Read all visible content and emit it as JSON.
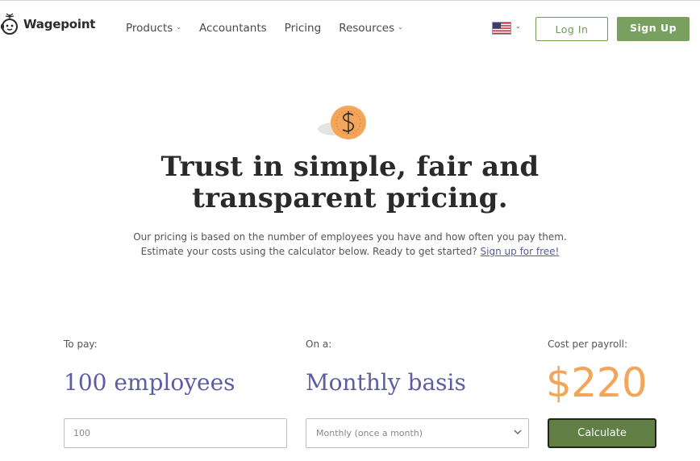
{
  "header": {
    "logo_text": "Wagepoint",
    "nav": [
      {
        "label": "Products",
        "has_dropdown": true
      },
      {
        "label": "Accountants",
        "has_dropdown": false
      },
      {
        "label": "Pricing",
        "has_dropdown": false
      },
      {
        "label": "Resources",
        "has_dropdown": true
      }
    ],
    "locale_icon": "us-flag-icon",
    "login_label": "Log In",
    "signup_label": "Sign Up"
  },
  "hero": {
    "icon": "dollar-coin-icon",
    "title_line1": "Trust in simple, fair and",
    "title_line2": "transparent pricing.",
    "subtitle_line1": "Our pricing is based on the number of employees you have and how often you pay them.",
    "subtitle_line2": "Estimate your costs using the calculator below. Ready to get started?",
    "signup_link": "Sign up for free!"
  },
  "calculator": {
    "employees_label": "To pay:",
    "employees_value": "100 employees",
    "employees_input_placeholder": "100",
    "frequency_label": "On a:",
    "frequency_value": "Monthly basis",
    "frequency_selected": "Monthly (once a month)",
    "cost_label": "Cost per payroll:",
    "cost_value": "$220",
    "calculate_label": "Calculate"
  },
  "colors": {
    "brand_green": "#7aa05f",
    "calc_button": "#617f45",
    "accent_purple": "#5d5ca6",
    "cost_orange": "#f3a65a"
  }
}
